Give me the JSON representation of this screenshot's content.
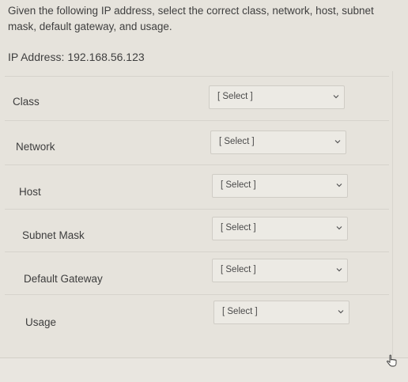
{
  "question": {
    "text": "Given the following IP address, select the correct class, network, host, subnet mask, default gateway, and usage."
  },
  "ip": {
    "label": "IP Address:",
    "value": "192.168.56.123"
  },
  "rows": [
    {
      "label": "Class",
      "select": "[ Select ]"
    },
    {
      "label": "Network",
      "select": "[ Select ]"
    },
    {
      "label": "Host",
      "select": "[ Select ]"
    },
    {
      "label": "Subnet Mask",
      "select": "[ Select ]"
    },
    {
      "label": "Default Gateway",
      "select": "[ Select ]"
    },
    {
      "label": "Usage",
      "select": "[ Select ]"
    }
  ],
  "icons": {
    "dropdown": "chevron-down-icon",
    "cursor": "hand-pointer-icon"
  }
}
